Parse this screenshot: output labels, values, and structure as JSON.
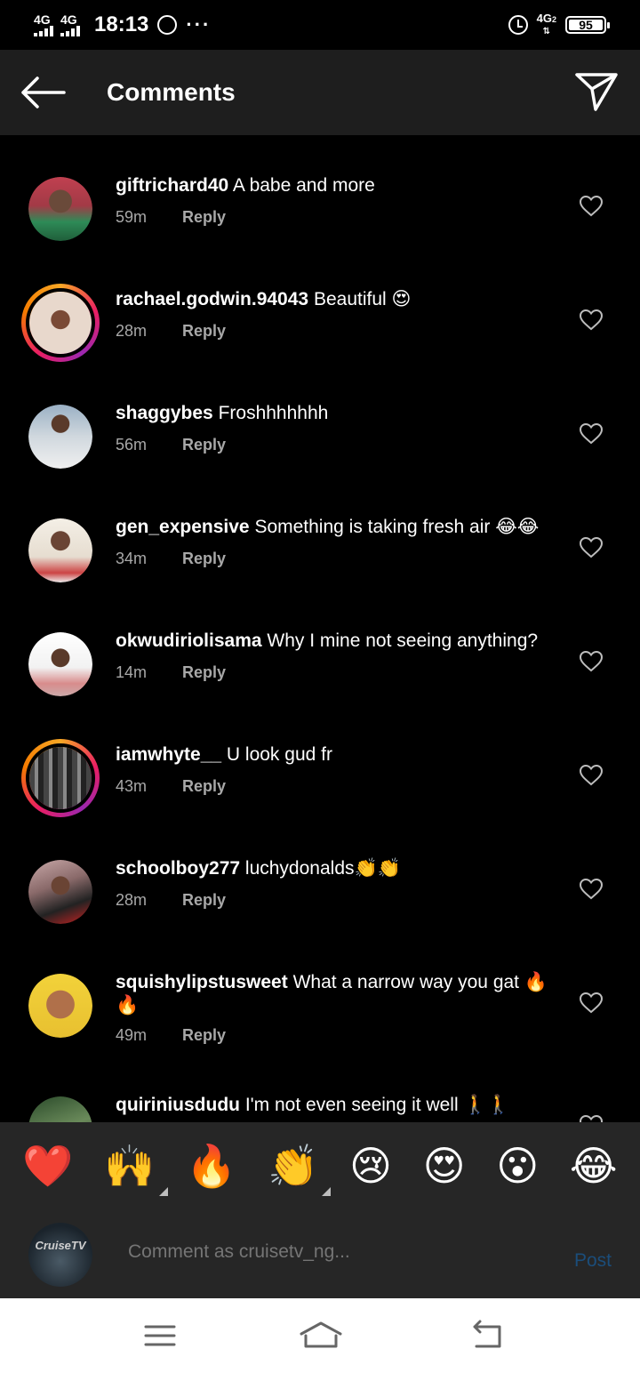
{
  "status_bar": {
    "network_1": "4G",
    "network_2": "4G",
    "time": "18:13",
    "more": "···",
    "network_3": "4G",
    "network_3_sub": "2",
    "battery": "95"
  },
  "header": {
    "title": "Comments"
  },
  "comments": [
    {
      "user": "giftrichard40",
      "text": "A babe and more",
      "time": "59m",
      "reply": "Reply"
    },
    {
      "user": "rachael.godwin.94043",
      "text": "Beautiful 😍",
      "time": "28m",
      "reply": "Reply"
    },
    {
      "user": "shaggybes",
      "text": "Froshhhhhhh",
      "time": "56m",
      "reply": "Reply"
    },
    {
      "user": "gen_expensive",
      "text": "Something is taking fresh air 😂😂",
      "time": "34m",
      "reply": "Reply"
    },
    {
      "user": "okwudiriolisama",
      "text": "Why I mine not seeing anything?",
      "time": "14m",
      "reply": "Reply"
    },
    {
      "user": "iamwhyte__",
      "text": "U look gud fr",
      "time": "43m",
      "reply": "Reply"
    },
    {
      "user": "schoolboy277",
      "text": "luchydonalds👏👏",
      "time": "28m",
      "reply": "Reply"
    },
    {
      "user": "squishylipstusweet",
      "text": "What a narrow way you gat 🔥🔥",
      "time": "49m",
      "reply": "Reply"
    },
    {
      "user": "quiriniusdudu",
      "text": "I'm not even seeing it well 🚶🚶",
      "time": "",
      "reply": ""
    }
  ],
  "emoji_bar": [
    "❤️",
    "🙌",
    "🔥",
    "👏",
    "😢",
    "😍",
    "😮",
    "😂"
  ],
  "composer": {
    "avatar_text": "CruiseTV",
    "placeholder": "Comment as cruisetv_ng...",
    "post_label": "Post"
  }
}
